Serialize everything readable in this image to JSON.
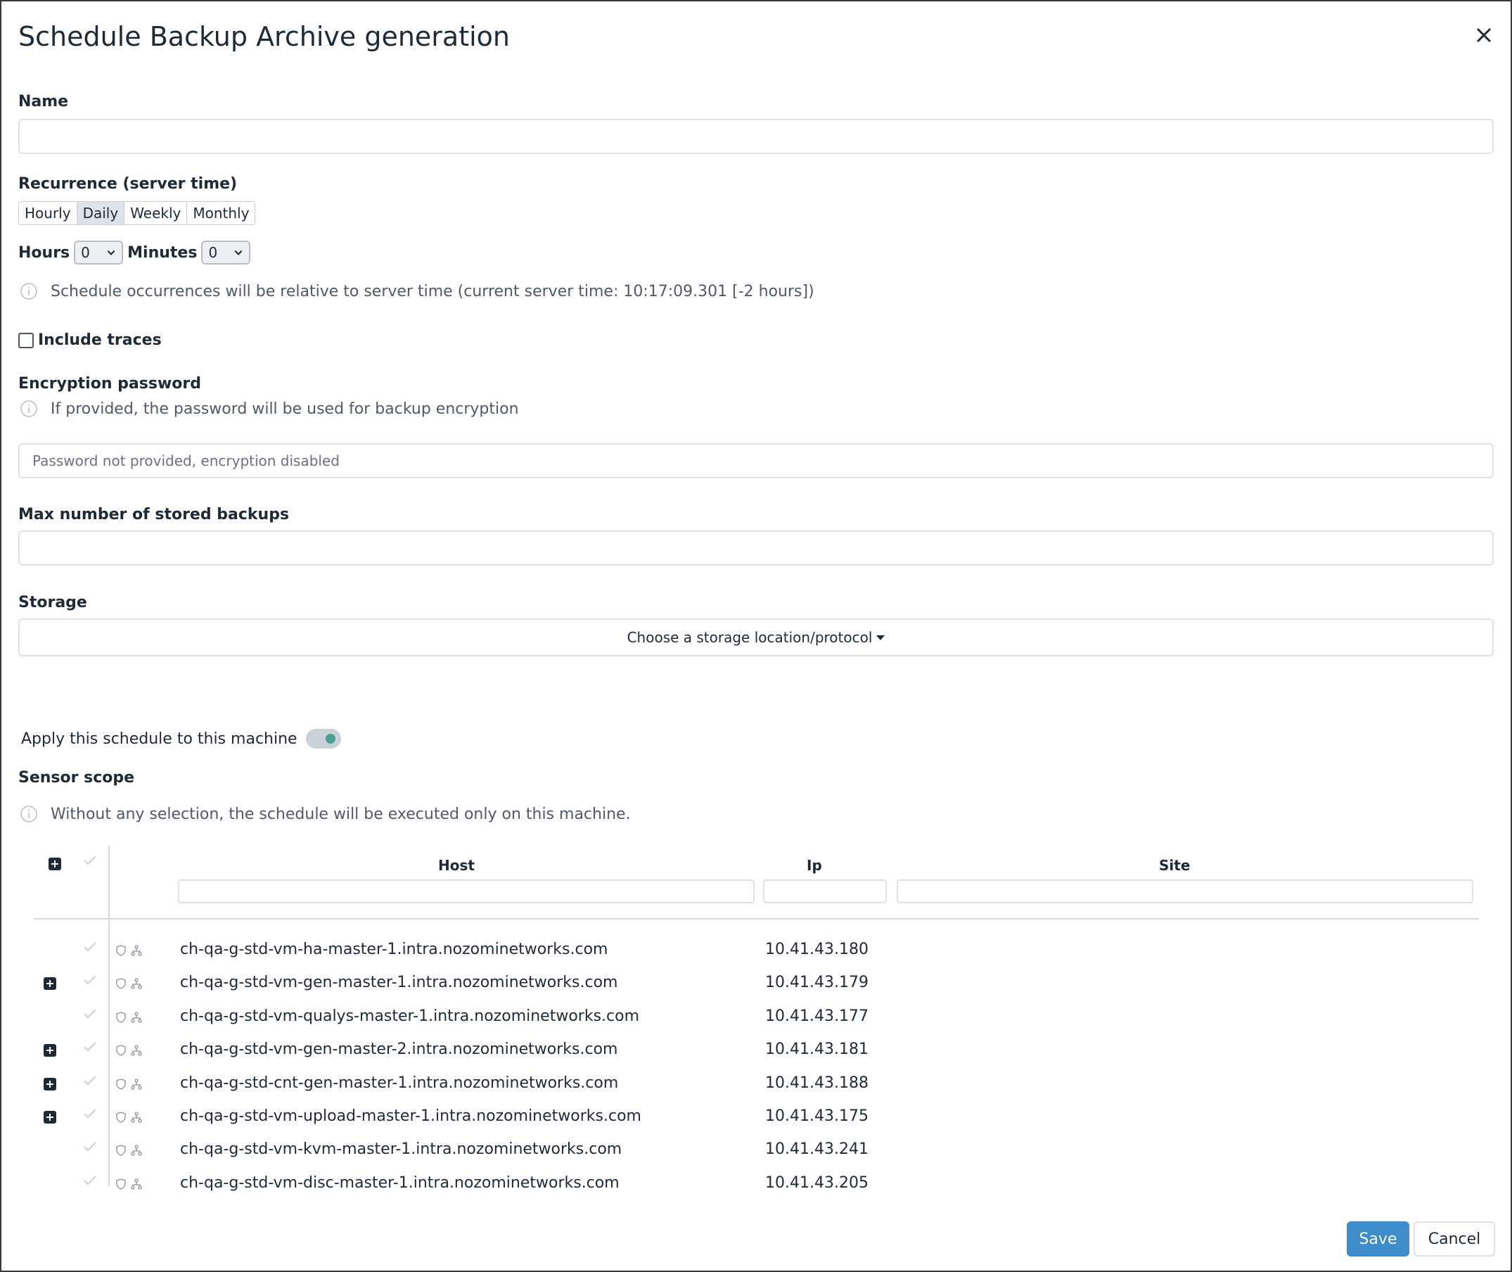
{
  "dialog": {
    "title": "Schedule Backup Archive generation"
  },
  "name": {
    "label": "Name",
    "value": "",
    "placeholder": ""
  },
  "recurrence": {
    "label": "Recurrence (server time)",
    "options": [
      "Hourly",
      "Daily",
      "Weekly",
      "Monthly"
    ],
    "selected": "Daily"
  },
  "time": {
    "hours_label": "Hours",
    "hours_value": "0",
    "minutes_label": "Minutes",
    "minutes_value": "0"
  },
  "server_time_note": "Schedule occurrences will be relative to server time (current server time: 10:17:09.301 [-2 hours])",
  "include_traces": {
    "label": "Include traces",
    "checked": false
  },
  "encryption": {
    "label": "Encryption password",
    "note": "If provided, the password will be used for backup encryption",
    "placeholder": "Password not provided, encryption disabled"
  },
  "max_backups": {
    "label": "Max number of stored backups",
    "value": ""
  },
  "storage": {
    "label": "Storage",
    "dropdown": "Choose a storage location/protocol"
  },
  "apply_machine": {
    "label": "Apply this schedule to this machine",
    "enabled": true
  },
  "sensor_scope": {
    "label": "Sensor scope",
    "note": "Without any selection, the schedule will be executed only on this machine.",
    "columns": [
      "Host",
      "Ip",
      "Site"
    ],
    "rows": [
      {
        "host": "ch-qa-g-std-vm-ha-master-1.intra.nozominetworks.com",
        "ip": "10.41.43.180",
        "site": "",
        "expandable": false
      },
      {
        "host": "ch-qa-g-std-vm-gen-master-1.intra.nozominetworks.com",
        "ip": "10.41.43.179",
        "site": "",
        "expandable": true
      },
      {
        "host": "ch-qa-g-std-vm-qualys-master-1.intra.nozominetworks.com",
        "ip": "10.41.43.177",
        "site": "",
        "expandable": false
      },
      {
        "host": "ch-qa-g-std-vm-gen-master-2.intra.nozominetworks.com",
        "ip": "10.41.43.181",
        "site": "",
        "expandable": true
      },
      {
        "host": "ch-qa-g-std-cnt-gen-master-1.intra.nozominetworks.com",
        "ip": "10.41.43.188",
        "site": "",
        "expandable": true
      },
      {
        "host": "ch-qa-g-std-vm-upload-master-1.intra.nozominetworks.com",
        "ip": "10.41.43.175",
        "site": "",
        "expandable": true
      },
      {
        "host": "ch-qa-g-std-vm-kvm-master-1.intra.nozominetworks.com",
        "ip": "10.41.43.241",
        "site": "",
        "expandable": false
      },
      {
        "host": "ch-qa-g-std-vm-disc-master-1.intra.nozominetworks.com",
        "ip": "10.41.43.205",
        "site": "",
        "expandable": false
      }
    ]
  },
  "footer": {
    "save": "Save",
    "cancel": "Cancel"
  },
  "colors": {
    "primary": "#3f8ccb",
    "toggle_on": "#4a9d92",
    "border": "#dfe3e8",
    "text": "#1f2a37"
  },
  "icons": {
    "close": "close-icon",
    "info": "info-icon",
    "expand": "plus-square-icon",
    "check": "check-icon",
    "shield": "shield-icon",
    "network": "network-icon"
  }
}
